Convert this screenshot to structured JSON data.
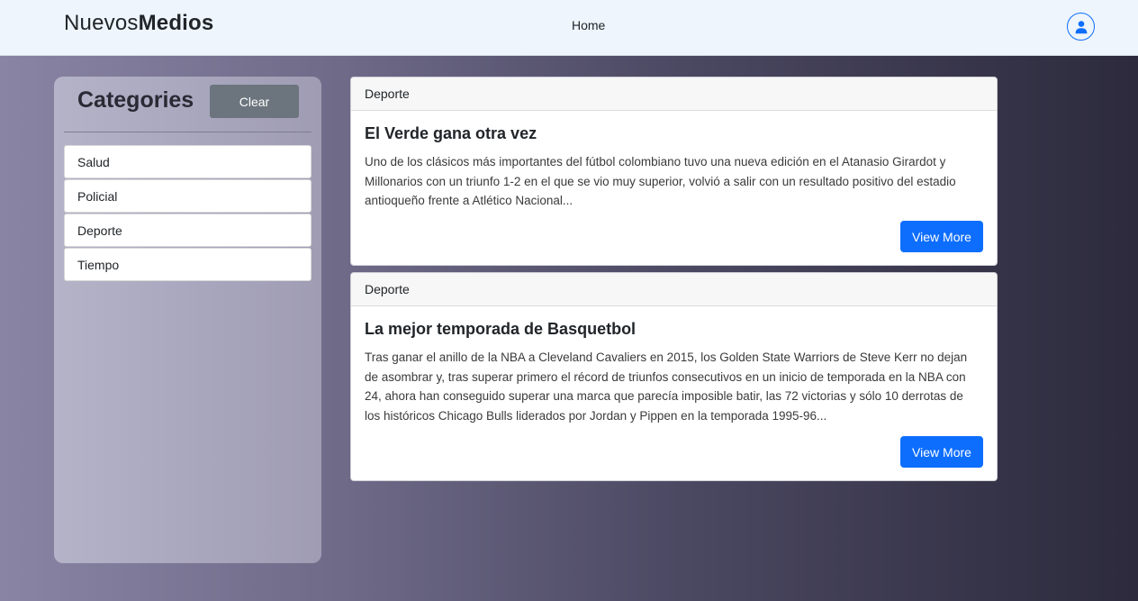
{
  "navbar": {
    "brand_part1": "Nuevos",
    "brand_part2": "Medios",
    "home_label": "Home",
    "user_icon": "user-circle-icon"
  },
  "sidebar": {
    "title": "Categories",
    "clear_label": "Clear",
    "items": [
      {
        "label": "Salud"
      },
      {
        "label": "Policial"
      },
      {
        "label": "Deporte"
      },
      {
        "label": "Tiempo"
      }
    ]
  },
  "articles": [
    {
      "category": "Deporte",
      "title": "El Verde gana otra vez",
      "summary": "Uno de los clásicos más importantes del fútbol colombiano tuvo una nueva edición en el Atanasio Girardot y Millonarios con un triunfo 1-2 en el que se vio muy superior, volvió a salir con un resultado positivo del estadio antioqueño frente a Atlético Nacional...",
      "button_label": "View More"
    },
    {
      "category": "Deporte",
      "title": "La mejor temporada de Basquetbol",
      "summary": "Tras ganar el anillo de la NBA a Cleveland Cavaliers en 2015, los Golden State Warriors de Steve Kerr no dejan de asombrar y, tras superar primero el récord de triunfos consecutivos en un inicio de temporada en la NBA con 24, ahora han conseguido superar una marca que parecía imposible batir, las 72 victorias y sólo 10 derrotas de los históricos Chicago Bulls liderados por Jordan y Pippen en la temporada 1995-96...",
      "button_label": "View More"
    }
  ],
  "colors": {
    "primary": "#0d6efd",
    "secondary": "#6c757d",
    "navbar_bg": "#eef5fc"
  }
}
